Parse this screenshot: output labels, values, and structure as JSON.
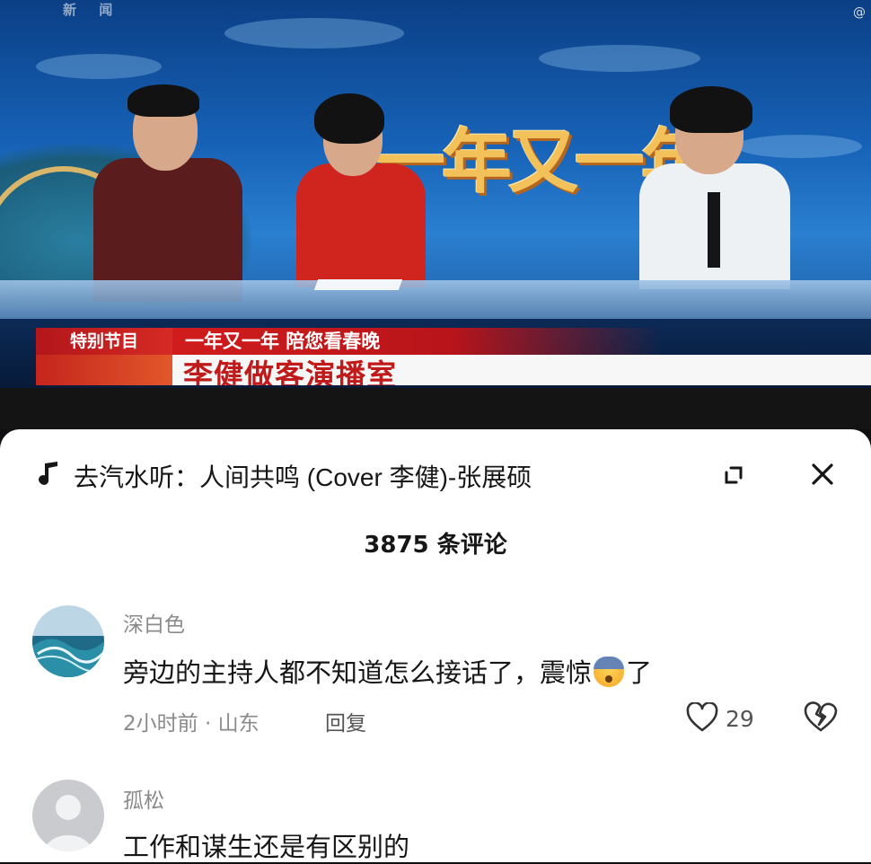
{
  "video": {
    "banner_title": "一年又一年",
    "tag_label": "特别节目",
    "headline_line1": "一年又一年 陪您看春晚",
    "headline_line2": "李健做客演播室",
    "watermark": "新 闻",
    "corner_mark": "@"
  },
  "sheet": {
    "music_title": "去汽水听：人间共鸣 (Cover 李健)-张展硕",
    "comment_count": "3875 条评论",
    "icons": {
      "music": "music-note-icon",
      "expand": "expand-icon",
      "close": "close-icon",
      "like": "heart-icon",
      "dislike": "broken-heart-icon",
      "emoji": "fearful-face-emoji"
    }
  },
  "comments": [
    {
      "user": "深白色",
      "text_before": "旁边的主持人都不知道怎么接话了，震惊",
      "text_after": "了",
      "time_location": "2小时前 · 山东",
      "reply_label": "回复",
      "likes": "29"
    },
    {
      "user": "孤松",
      "text": "工作和谋生还是有区别的"
    }
  ]
}
